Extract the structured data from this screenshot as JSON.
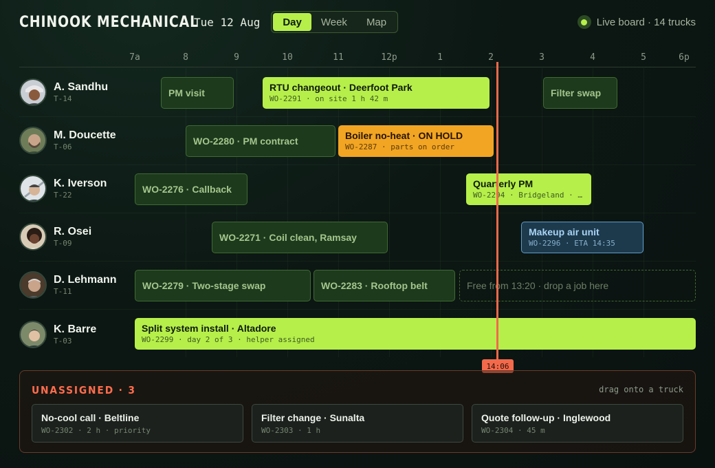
{
  "header": {
    "brand": "CHINOOK MECHANICAL",
    "date": "Tue 12 Aug",
    "views": [
      {
        "label": "Day",
        "active": true
      },
      {
        "label": "Week",
        "active": false
      },
      {
        "label": "Map",
        "active": false
      }
    ],
    "live_status": "Live board · 14 trucks"
  },
  "timeline": {
    "ticks": [
      "7a",
      "8",
      "9",
      "10",
      "11",
      "12p",
      "1",
      "2",
      "3",
      "4",
      "5",
      "6p"
    ],
    "now_label": "14:06"
  },
  "technicians": [
    {
      "name": "A. Sandhu",
      "truck": "T-14"
    },
    {
      "name": "M. Doucette",
      "truck": "T-06"
    },
    {
      "name": "K. Iverson",
      "truck": "T-22"
    },
    {
      "name": "R. Osei",
      "truck": "T-09"
    },
    {
      "name": "D. Lehmann",
      "truck": "T-11"
    },
    {
      "name": "K. Barre",
      "truck": "T-03"
    }
  ],
  "jobs": [
    {
      "title": "PM visit",
      "detail": "",
      "style": "dim"
    },
    {
      "title": "RTU changeout · Deerfoot Park",
      "detail": "WO-2291 · on site 1 h 42 m",
      "style": "lime"
    },
    {
      "title": "Filter swap",
      "detail": "",
      "style": "dim"
    },
    {
      "title": "WO-2280 · PM contract",
      "detail": "",
      "style": "dim"
    },
    {
      "title": "Boiler no-heat · ON HOLD",
      "detail": "WO-2287 · parts on order",
      "style": "amber"
    },
    {
      "title": "WO-2276 · Callback",
      "detail": "",
      "style": "dim"
    },
    {
      "title": "Quarterly PM",
      "detail": "WO-2294 · Bridgeland · …",
      "style": "lime"
    },
    {
      "title": "WO-2271 · Coil clean, Ramsay",
      "detail": "",
      "style": "dim"
    },
    {
      "title": "Makeup air unit",
      "detail": "WO-2296 · ETA 14:35",
      "style": "blue"
    },
    {
      "title": "WO-2279 · Two-stage swap",
      "detail": "",
      "style": "dim"
    },
    {
      "title": "WO-2283 · Rooftop belt",
      "detail": "",
      "style": "dim"
    },
    {
      "title": "Free from 13:20 · drop a job here",
      "detail": "",
      "style": "free"
    },
    {
      "title": "Split system install · Altadore",
      "detail": "WO-2299 · day 2 of 3 · helper assigned",
      "style": "lime"
    }
  ],
  "unassigned": {
    "title": "UNASSIGNED · 3",
    "hint": "drag onto a truck",
    "cards": [
      {
        "title": "No-cool call · Beltline",
        "detail": "WO-2302 · 2 h · priority"
      },
      {
        "title": "Filter change · Sunalta",
        "detail": "WO-2303 · 1 h"
      },
      {
        "title": "Quote follow-up · Inglewood",
        "detail": "WO-2304 · 45 m"
      }
    ]
  },
  "colors": {
    "accent": "#b6ef4a",
    "hold": "#f2a523",
    "now": "#f26a4b",
    "pending": "#5f9ccc",
    "unassigned": "#ff6d4d"
  }
}
